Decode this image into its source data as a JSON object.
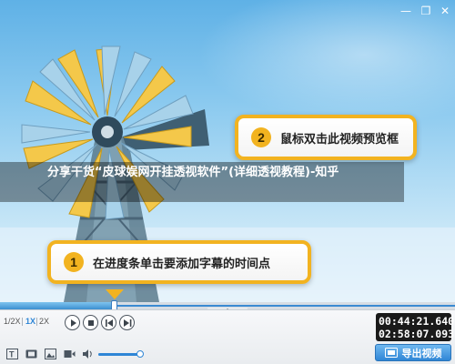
{
  "window": {
    "minimize_glyph": "—",
    "maximize_glyph": "❐",
    "close_glyph": "✕"
  },
  "video": {
    "title": "分享干货“皮球娱网开挂透视软件”(详细透视教程)-知乎",
    "callouts": [
      {
        "number": "2",
        "text": "鼠标双击此视频预览框"
      },
      {
        "number": "1",
        "text": "在进度条单击要添加字幕的时间点"
      }
    ],
    "colors": {
      "accent": "#f2b320",
      "sky": "#8ccaef"
    }
  },
  "timeline": {
    "progress": 0.25,
    "collapse_glyph": "⌃"
  },
  "controls": {
    "speeds": [
      "1/2X",
      "1X",
      "2X"
    ],
    "active_speed": "1X",
    "volume": 0.95,
    "current_time": "00:44:21.640",
    "total_time": "02:58:07.093",
    "export_label": "导出视频",
    "icons": [
      "play-icon",
      "stop-icon",
      "previous-frame-icon",
      "next-frame-icon",
      "text-icon",
      "film-icon",
      "gallery-icon",
      "video-icon",
      "volume-icon",
      "export-icon"
    ],
    "accent_color": "#2e86d6"
  }
}
